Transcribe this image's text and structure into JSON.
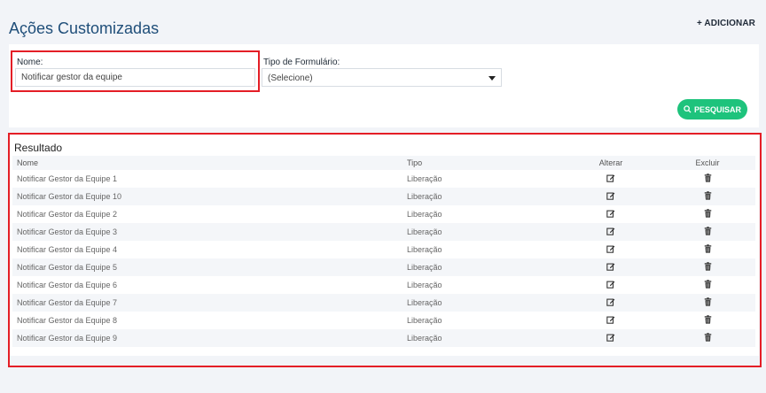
{
  "page": {
    "title": "Ações Customizadas",
    "add_label": "+ ADICIONAR"
  },
  "filters": {
    "nome_label": "Nome:",
    "nome_value": "Notificar gestor da equipe",
    "tipo_label": "Tipo de Formulário:",
    "tipo_selected": "(Selecione)",
    "search_label": "PESQUISAR"
  },
  "results": {
    "title": "Resultado",
    "columns": {
      "nome": "Nome",
      "tipo": "Tipo",
      "alterar": "Alterar",
      "excluir": "Excluir"
    },
    "rows": [
      {
        "nome": "Notificar Gestor da Equipe 1",
        "tipo": "Liberação"
      },
      {
        "nome": "Notificar Gestor da Equipe 10",
        "tipo": "Liberação"
      },
      {
        "nome": "Notificar Gestor da Equipe 2",
        "tipo": "Liberação"
      },
      {
        "nome": "Notificar Gestor da Equipe 3",
        "tipo": "Liberação"
      },
      {
        "nome": "Notificar Gestor da Equipe 4",
        "tipo": "Liberação"
      },
      {
        "nome": "Notificar Gestor da Equipe 5",
        "tipo": "Liberação"
      },
      {
        "nome": "Notificar Gestor da Equipe 6",
        "tipo": "Liberação"
      },
      {
        "nome": "Notificar Gestor da Equipe 7",
        "tipo": "Liberação"
      },
      {
        "nome": "Notificar Gestor da Equipe 8",
        "tipo": "Liberação"
      },
      {
        "nome": "Notificar Gestor da Equipe 9",
        "tipo": "Liberação"
      }
    ]
  },
  "icons": {
    "edit": "edit-icon",
    "delete": "trash-icon",
    "search": "search-icon",
    "dropdown": "caret-down-icon"
  },
  "colors": {
    "title": "#1f4e79",
    "search_button": "#1ec37c",
    "highlight": "#e41e26",
    "background": "#f2f4f8"
  }
}
